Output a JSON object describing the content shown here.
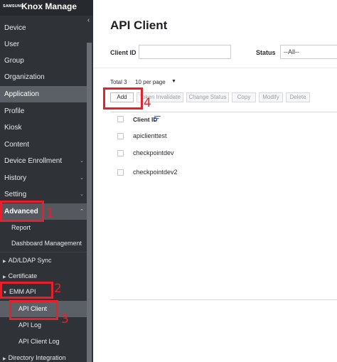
{
  "brand": {
    "samsung": "SAMSUNG",
    "product": "Knox Manage"
  },
  "sidebar": {
    "items": [
      {
        "label": "Device"
      },
      {
        "label": "User"
      },
      {
        "label": "Group"
      },
      {
        "label": "Organization"
      },
      {
        "label": "Application"
      },
      {
        "label": "Profile"
      },
      {
        "label": "Kiosk"
      },
      {
        "label": "Content"
      },
      {
        "label": "Device Enrollment"
      },
      {
        "label": "History"
      },
      {
        "label": "Setting"
      },
      {
        "label": "Advanced"
      }
    ],
    "advanced_sub": [
      "Report",
      "Dashboard Management"
    ],
    "groups": [
      "AD/LDAP Sync",
      "Certificate",
      "EMM API"
    ],
    "emm_leaves": [
      "API Client",
      "API Log",
      "API Client Log"
    ],
    "last_group": "Directory Integration"
  },
  "main": {
    "title": "API Client",
    "filters": {
      "client_id_label": "Client ID",
      "status_label": "Status",
      "status_value": "--All--"
    },
    "total_label": "Total",
    "total_count": "3",
    "per_page": "10 per page",
    "buttons": {
      "add": "Add",
      "token_invalidate": "Token Invalidate",
      "change_status": "Change Status",
      "copy": "Copy",
      "modify": "Modify",
      "delete": "Delete"
    },
    "table": {
      "column_client_id": "Client ID",
      "rows": [
        "apiclienttest",
        "checkpointdev",
        "checkpointdev2"
      ]
    }
  },
  "annotations": {
    "n1": "1",
    "n2": "2",
    "n3": "3",
    "n4": "4",
    "color": "#e8202a"
  }
}
